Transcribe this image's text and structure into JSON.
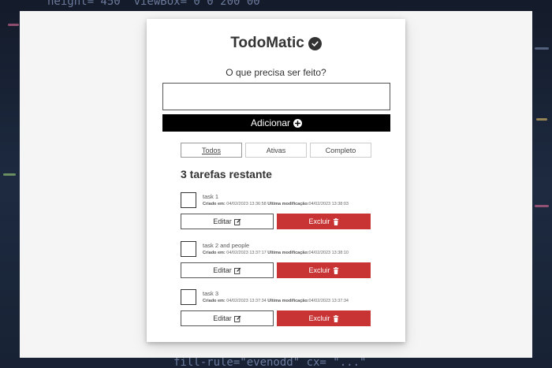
{
  "app": {
    "title": "TodoMatic"
  },
  "form": {
    "prompt": "O que precisa ser feito?",
    "input_value": "",
    "add_label": "Adicionar"
  },
  "filters": [
    {
      "label": "Todos",
      "active": true
    },
    {
      "label": "Ativas",
      "active": false
    },
    {
      "label": "Completo",
      "active": false
    }
  ],
  "remaining_label": "3 tarefas restante",
  "tasks": [
    {
      "name": "task 1",
      "created_label": "Criado em:",
      "created": "04/02/2023 13:36:58",
      "modified_label": "Ultima modificação:",
      "modified": "04/02/2023 13:38:03",
      "checked": false,
      "edit_label": "Editar",
      "delete_label": "Excluir"
    },
    {
      "name": "task 2 and people",
      "created_label": "Criado em:",
      "created": "04/02/2023 13:37:17",
      "modified_label": "Ultima modificação:",
      "modified": "04/02/2023 13:38:10",
      "checked": false,
      "edit_label": "Editar",
      "delete_label": "Excluir"
    },
    {
      "name": "task 3",
      "created_label": "Criado em:",
      "created": "04/02/2023 13:37:34",
      "modified_label": "Ultima modificação:",
      "modified": "04/02/2023 13:37:34",
      "checked": false,
      "edit_label": "Editar",
      "delete_label": "Excluir"
    }
  ],
  "icons": {
    "title": "check-circle-icon",
    "add": "plus-circle-icon",
    "edit": "edit-icon",
    "delete": "trash-icon"
  },
  "colors": {
    "delete_button": "#c83434",
    "add_button": "#000000",
    "title_text": "#333333"
  },
  "backdrop": {
    "code_top": "height=\"450\" viewBox=\"0 0 200 00\"",
    "code_bottom": "fill-rule=\"evenodd\" cx= \"...\""
  }
}
